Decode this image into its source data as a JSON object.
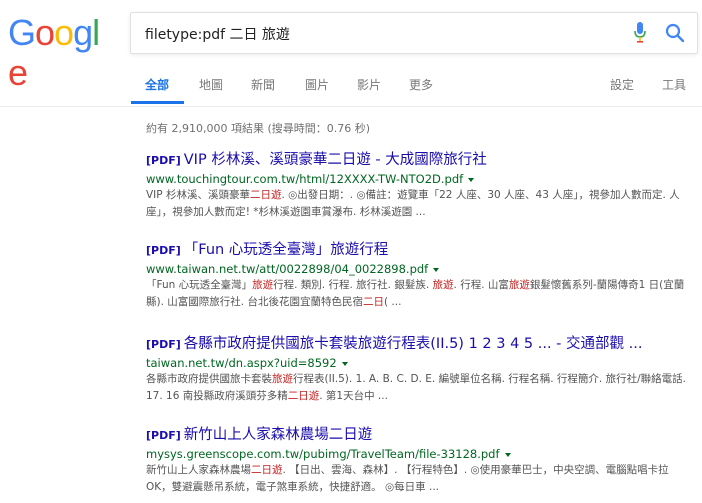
{
  "logo": {
    "letters": [
      "G",
      "o",
      "o",
      "g",
      "l",
      "e"
    ],
    "colors": [
      "#4285f4",
      "#ea4335",
      "#fbbc05",
      "#4285f4",
      "#34a853",
      "#ea4335"
    ]
  },
  "search": {
    "query": "filetype:pdf 二日 旅遊",
    "mic_icon": "microphone-icon",
    "search_icon": "magnifier-icon"
  },
  "tabs": {
    "all": "全部",
    "maps": "地圖",
    "news": "新聞",
    "images": "圖片",
    "videos": "影片",
    "more": "更多",
    "settings": "設定",
    "tools": "工具"
  },
  "stats": "約有 2,910,000 項結果 (搜尋時間：0.76 秒)",
  "results": [
    {
      "tag": "[PDF]",
      "title": "VIP 杉林溪、溪頭豪華二日遊 - 大成國際旅行社",
      "url": "www.touchingtour.com.tw/html/12XXXX-TW-NTO2D.pdf",
      "snippet": [
        {
          "t": "VIP 杉林溪、溪頭豪華"
        },
        {
          "t": "二日遊",
          "hl": true
        },
        {
          "t": ". ◎出發日期：. ◎備註：遊覽車「22 人座、30 人座、43 人座」，視參加人數而定. 人座」，視參加人數而定! *杉林溪遊園車賞瀑布. 杉林溪遊園 ..."
        }
      ]
    },
    {
      "tag": "[PDF]",
      "title": "「Fun 心玩透全臺灣」旅遊行程",
      "url": "www.taiwan.net.tw/att/0022898/04_0022898.pdf",
      "snippet": [
        {
          "t": "「Fun 心玩透全臺灣」"
        },
        {
          "t": "旅遊",
          "hl": true
        },
        {
          "t": "行程. 類別. 行程. 旅行社. 銀髮族. "
        },
        {
          "t": "旅遊",
          "hl": true
        },
        {
          "t": ". 行程. 山富"
        },
        {
          "t": "旅遊",
          "hl": true
        },
        {
          "t": "銀髮懷舊系列-蘭陽傳奇1 日(宜蘭縣). 山富國際旅行社. 台北後花園宜蘭特色民宿"
        },
        {
          "t": "二日",
          "hl": true
        },
        {
          "t": "( ..."
        }
      ]
    },
    {
      "tag": "[PDF]",
      "title": "各縣市政府提供國旅卡套裝旅遊行程表(II.5) 1 2 3 4 5 ... - 交通部觀 ...",
      "url": "taiwan.net.tw/dn.aspx?uid=8592",
      "snippet": [
        {
          "t": "各縣市政府提供國旅卡套裝"
        },
        {
          "t": "旅遊",
          "hl": true
        },
        {
          "t": "行程表(II.5). 1. A. B. C. D. E. 編號單位名稱. 行程名稱. 行程簡介. 旅行社/聯絡電話. 17. 16 南投縣政府溪頭芬多精"
        },
        {
          "t": "二日遊",
          "hl": true
        },
        {
          "t": ". 第1天台中 ..."
        }
      ]
    },
    {
      "tag": "[PDF]",
      "title": "新竹山上人家森林農場二日遊",
      "url": "mysys.greenscope.com.tw/pubimg/TravelTeam/file-33128.pdf",
      "snippet": [
        {
          "t": "新竹山上人家森林農場"
        },
        {
          "t": "二日遊",
          "hl": true
        },
        {
          "t": ". 【日出、雲海、森林】. 【行程特色】. ◎使用豪華巴士，中央空調、電腦點唱卡拉OK，雙避震懸吊系統，電子煞車系統，快捷舒適。 ◎每日車 ..."
        }
      ]
    }
  ]
}
